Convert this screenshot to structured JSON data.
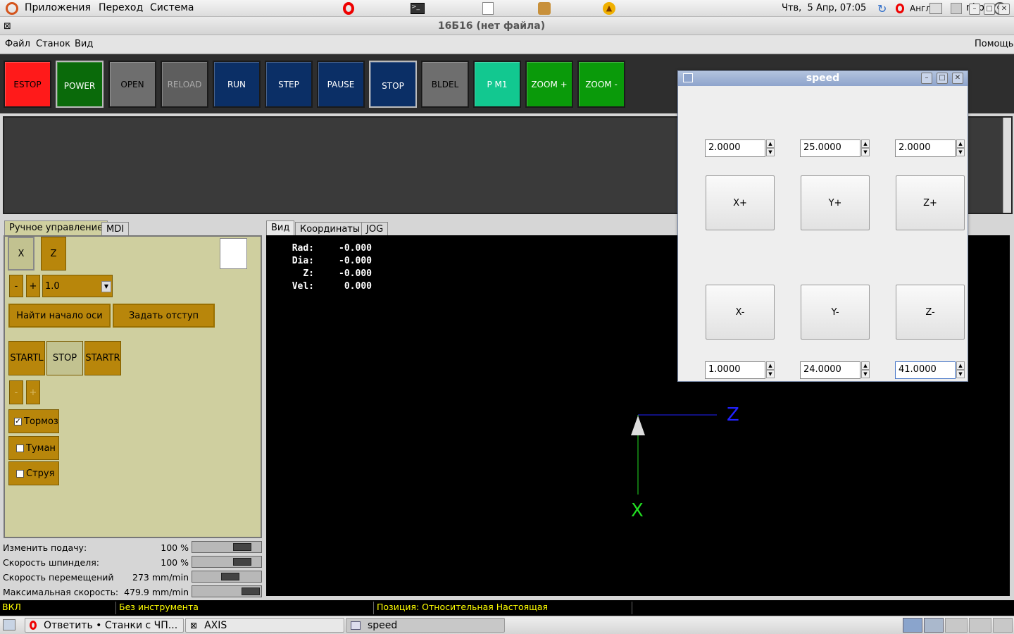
{
  "top_panel": {
    "menus": [
      "Приложения",
      "Переход",
      "Система"
    ],
    "clock": "Чтв,  5 Апр, 07:05",
    "keyboard_layout": "Англ",
    "username": "nkp"
  },
  "window": {
    "title": "16Б16 (нет файла)",
    "menus": [
      "Файл",
      "Станок",
      "Вид"
    ],
    "help": "Помощь"
  },
  "toolbar": [
    {
      "label": "ESTOP",
      "color": "#ff1a1a"
    },
    {
      "label": "POWER",
      "color": "#0a6a0a"
    },
    {
      "label": "OPEN",
      "color": "#6e6e6e"
    },
    {
      "label": "RELOAD",
      "color": "#5e5e5e"
    },
    {
      "label": "RUN",
      "color": "#0b2f66"
    },
    {
      "label": "STEP",
      "color": "#0b2f66"
    },
    {
      "label": "PAUSE",
      "color": "#0b2f66"
    },
    {
      "label": "STOP",
      "color": "#0b2f66"
    },
    {
      "label": "BLDEL",
      "color": "#6e6e6e"
    },
    {
      "label": "P M1",
      "color": "#12c890"
    },
    {
      "label": "ZOOM +",
      "color": "#0a9a0a"
    },
    {
      "label": "ZOOM -",
      "color": "#0a9a0a"
    }
  ],
  "left_tabs": [
    "Ручное управление",
    "MDI"
  ],
  "manual": {
    "axis_x": "X",
    "axis_z": "Z",
    "minus": "-",
    "plus": "+",
    "increment": "1.0",
    "home_button": "Найти начало оси",
    "offset_button": "Задать отступ",
    "startl": "STARTL",
    "stop": "STOP",
    "startr": "STARTR",
    "spindle_minus": "-",
    "spindle_plus": "+",
    "brake": "Тормоз",
    "mist": "Туман",
    "flood": "Струя"
  },
  "sliders": [
    {
      "label": "Изменить подачу:",
      "value": "100 %",
      "level": 0.82
    },
    {
      "label": "Скорость шпинделя:",
      "value": "100 %",
      "level": 0.82
    },
    {
      "label": "Скорость перемещений",
      "value": "273 mm/min",
      "level": 0.57
    },
    {
      "label": "Максимальная скорость:",
      "value": "479.9 mm/min",
      "level": 1.0
    }
  ],
  "view_tabs": [
    "Вид",
    "Координаты",
    "JOG"
  ],
  "dro": [
    {
      "label": "Rad:",
      "value": "-0.000"
    },
    {
      "label": "Dia:",
      "value": "-0.000"
    },
    {
      "label": "Z:",
      "value": "-0.000"
    },
    {
      "label": "Vel:",
      "value": "0.000"
    }
  ],
  "axes": {
    "z": "Z",
    "x": "X"
  },
  "status": {
    "state": "ВКЛ",
    "tool": "Без инструмента",
    "position": "Позиция: Относительная Настоящая"
  },
  "taskbar": [
    {
      "label": "Ответить • Станки с ЧП..."
    },
    {
      "label": "AXIS"
    },
    {
      "label": "speed"
    }
  ],
  "speed_window": {
    "title": "speed",
    "top_values": [
      "2.0000",
      "25.0000",
      "2.0000"
    ],
    "plus_buttons": [
      "X+",
      "Y+",
      "Z+"
    ],
    "minus_buttons": [
      "X-",
      "Y-",
      "Z-"
    ],
    "bottom_values": [
      "1.0000",
      "24.0000",
      "41.0000"
    ]
  },
  "colors": {
    "axis_z": "#2222ff",
    "axis_x": "#22dd22",
    "status_text": "#ffff00"
  }
}
